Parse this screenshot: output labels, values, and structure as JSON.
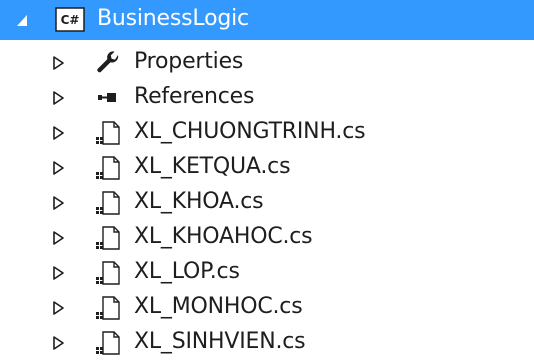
{
  "project": {
    "name": "BusinessLogic",
    "icon": "csharp-project-icon",
    "expanded": true
  },
  "items": [
    {
      "label": "Properties",
      "icon": "wrench-icon"
    },
    {
      "label": "References",
      "icon": "references-icon"
    },
    {
      "label": "XL_CHUONGTRINH.cs",
      "icon": "cs-file-icon"
    },
    {
      "label": "XL_KETQUA.cs",
      "icon": "cs-file-icon"
    },
    {
      "label": "XL_KHOA.cs",
      "icon": "cs-file-icon"
    },
    {
      "label": "XL_KHOAHOC.cs",
      "icon": "cs-file-icon"
    },
    {
      "label": "XL_LOP.cs",
      "icon": "cs-file-icon"
    },
    {
      "label": "XL_MONHOC.cs",
      "icon": "cs-file-icon"
    },
    {
      "label": "XL_SINHVIEN.cs",
      "icon": "cs-file-icon"
    }
  ],
  "colors": {
    "selection": "#3399ff",
    "text": "#1e1e1e",
    "icon": "#1e1e1e"
  }
}
